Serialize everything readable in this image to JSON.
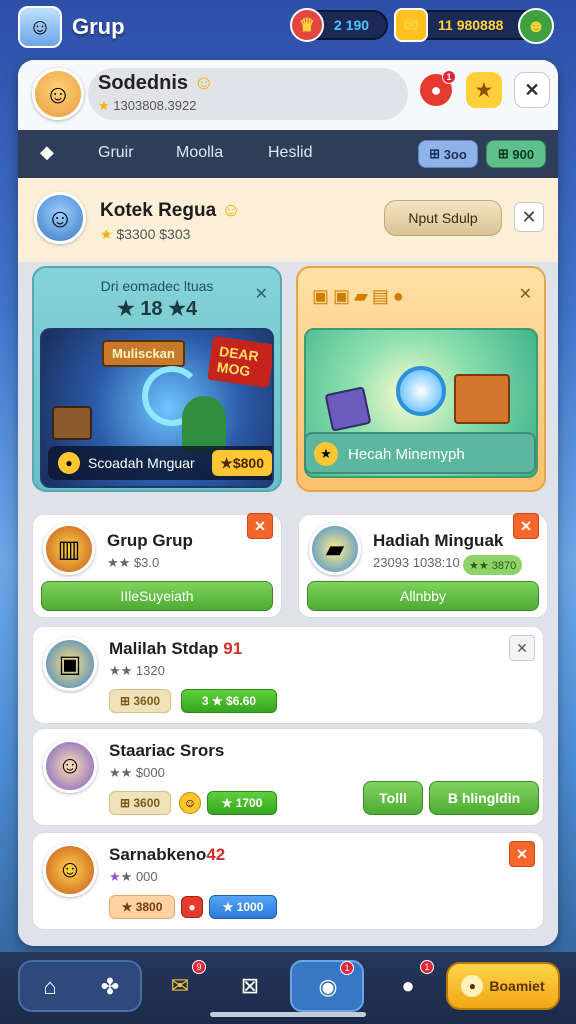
{
  "header": {
    "app_icon": "face-icon",
    "title": "Grup",
    "gems_value": "2 190",
    "coins_value": "11 980888"
  },
  "profile": {
    "name": "Sodednis",
    "stats": "1303808.3922"
  },
  "tabs": {
    "items": [
      "Gruir",
      "Moolla",
      "Heslid"
    ],
    "pill_blue": "3oo",
    "pill_green": "900"
  },
  "group": {
    "name": "Kotek Regua",
    "sub": "$3300 $303",
    "join_label": "Nput Sdulp"
  },
  "feature_left": {
    "title": "Dri eomadec ltuas",
    "count": "18 ★4",
    "sign1": "Mulisckan",
    "sign2": "DEAR MOG",
    "footer_label": "Scoadah Mnguar",
    "footer_value": "$800"
  },
  "feature_right": {
    "footer_label": "Hecah Minemyph"
  },
  "card_left": {
    "title": "Grup Grup",
    "sub": "$3.0",
    "button": "IIleSuyeiath"
  },
  "card_right": {
    "title": "Hadiah Minguak",
    "sub": "23093 1038:10",
    "tag": "★★ 3870",
    "button": "Allnbby"
  },
  "row1": {
    "title": "Malilah Stdap",
    "title_accent": " 91",
    "sub": "1320",
    "chip1": "3600",
    "chip2": "3 ★ $6.60"
  },
  "row2": {
    "title": "Staariac Srors",
    "sub": "$000",
    "chip1": "3600",
    "chip2": "1700",
    "btn1": "Tolll",
    "btn2": "B hlingldin"
  },
  "row3": {
    "title": "Sarnabkeno",
    "title_accent": "42",
    "sub": "000",
    "chip1": "3800",
    "chip2": "1000"
  },
  "bottom_nav": {
    "cta_label": "Boamiet",
    "badge1": "9",
    "badge2": "1",
    "badge3": "1"
  },
  "colors": {
    "accent_green": "#4eab34",
    "accent_orange": "#f4662a",
    "accent_gold": "#ffc631",
    "tabbar": "#2f3e58"
  }
}
